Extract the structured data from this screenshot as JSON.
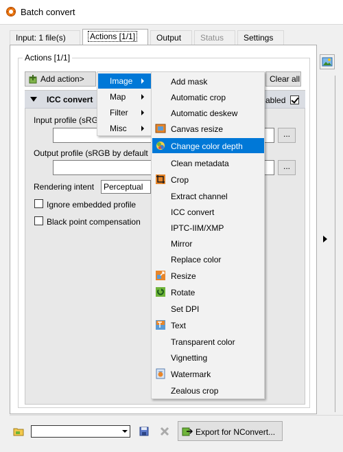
{
  "window": {
    "title": "Batch convert"
  },
  "tabs": [
    {
      "label": "Input: 1 file(s)",
      "state": "normal"
    },
    {
      "label": "Actions [1/1]",
      "state": "active"
    },
    {
      "label": "Output",
      "state": "normal"
    },
    {
      "label": "Status",
      "state": "disabled"
    },
    {
      "label": "Settings",
      "state": "normal"
    }
  ],
  "actions_group": {
    "label": "Actions [1/1]"
  },
  "toolbar": {
    "add_action": "Add action>",
    "clear_all": "Clear all"
  },
  "action": {
    "name": "ICC convert",
    "enabled_label": "abled",
    "enabled": true,
    "input_profile_label": "Input profile (sRG",
    "output_profile_label": "Output profile (sRGB by default",
    "browse_label": "...",
    "rendering_intent_label": "Rendering intent",
    "rendering_intent_value": "Perceptual",
    "ignore_embedded_label": "Ignore embedded profile",
    "black_point_label": "Black point compensation"
  },
  "menu_categories": [
    {
      "label": "Image",
      "selected": true
    },
    {
      "label": "Map",
      "selected": false
    },
    {
      "label": "Filter",
      "selected": false
    },
    {
      "label": "Misc",
      "selected": false
    }
  ],
  "menu_image_items": [
    {
      "label": "Add mask",
      "icon": ""
    },
    {
      "label": "Automatic crop",
      "icon": ""
    },
    {
      "label": "Automatic deskew",
      "icon": ""
    },
    {
      "label": "Canvas resize",
      "icon": "canvas-resize-icon"
    },
    {
      "label": "Change color depth",
      "icon": "color-depth-icon",
      "selected": true
    },
    {
      "label": "Clean metadata",
      "icon": ""
    },
    {
      "label": "Crop",
      "icon": "crop-icon"
    },
    {
      "label": "Extract channel",
      "icon": ""
    },
    {
      "label": "ICC convert",
      "icon": ""
    },
    {
      "label": "IPTC-IIM/XMP",
      "icon": ""
    },
    {
      "label": "Mirror",
      "icon": ""
    },
    {
      "label": "Replace color",
      "icon": ""
    },
    {
      "label": "Resize",
      "icon": "resize-icon"
    },
    {
      "label": "Rotate",
      "icon": "rotate-icon"
    },
    {
      "label": "Set DPI",
      "icon": ""
    },
    {
      "label": "Text",
      "icon": "text-icon"
    },
    {
      "label": "Transparent color",
      "icon": ""
    },
    {
      "label": "Vignetting",
      "icon": ""
    },
    {
      "label": "Watermark",
      "icon": "watermark-icon"
    },
    {
      "label": "Zealous crop",
      "icon": ""
    }
  ],
  "bottom": {
    "export_label": "Export for NConvert..."
  },
  "colors": {
    "accent": "#0078d7",
    "panel_header": "#dadde3"
  }
}
